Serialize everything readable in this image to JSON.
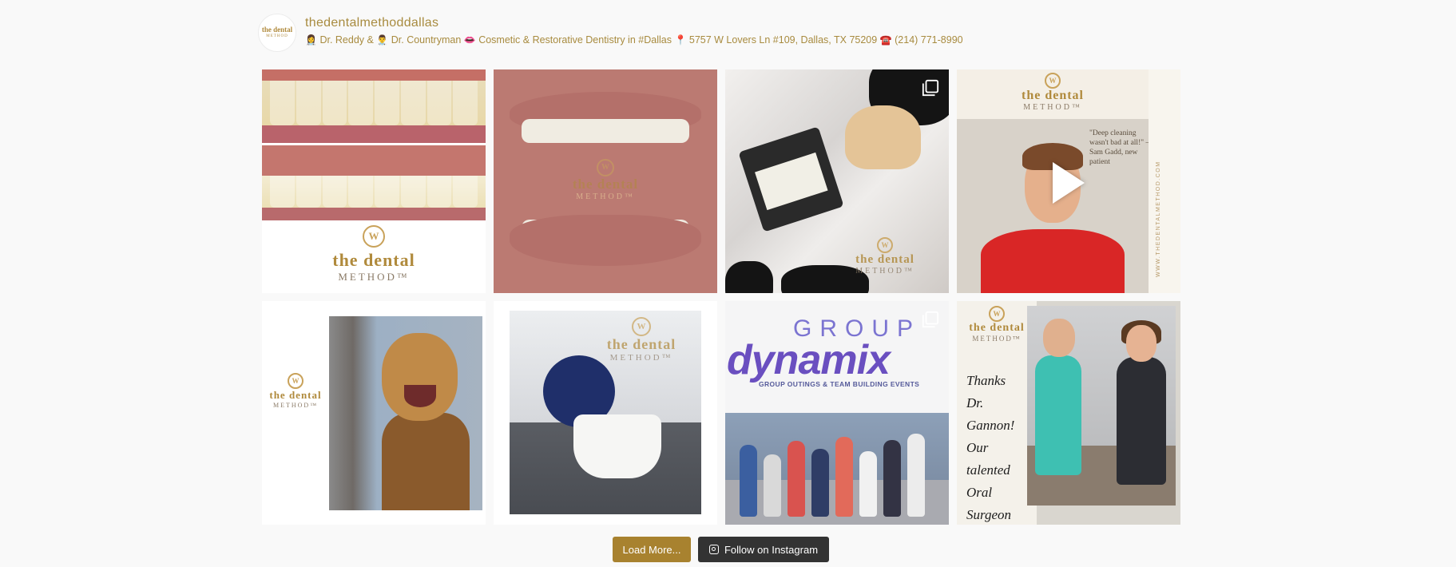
{
  "profile": {
    "username": "thedentalmethoddallas",
    "avatar_line1": "the dental",
    "avatar_line2": "METHOD",
    "bio": {
      "e1": "👩‍⚕️",
      "doc1": "Dr. Reddy & ",
      "e2": "👨‍⚕️",
      "doc2": "Dr. Countryman ",
      "e3": "👄",
      "desc": "Cosmetic & Restorative Dentistry in #Dallas ",
      "e4": "📍",
      "address": "5757 W Lovers Ln #109, Dallas, TX 75209 ",
      "e5": "☎️",
      "phone": "(214) 771-8990"
    }
  },
  "brand": {
    "monogram": "W",
    "name": "the dental",
    "sub": "METHOD™"
  },
  "tiles": {
    "t4_quote": "\"Deep cleaning wasn't bad at all!\" – Sam Gadd, new patient",
    "t4_side": "WWW.THEDENTALMETHOD.COM",
    "t7_group": "GROUP",
    "t7_dynamix": "dynamix",
    "t7_tagline": "GROUP OUTINGS & TEAM BUILDING EVENTS",
    "t8_note": [
      "Thanks",
      "Dr.",
      "Gannon!",
      "Our",
      "talented",
      "Oral",
      "Surgeon"
    ]
  },
  "icons": {
    "gallery": "gallery-icon",
    "play": "play-icon",
    "instagram": "instagram-icon"
  },
  "buttons": {
    "load_more": "Load More...",
    "follow": "Follow on Instagram"
  },
  "colors": {
    "accent": "#a8822f",
    "dark_button": "#333333",
    "text_gold": "#a88b3f"
  }
}
